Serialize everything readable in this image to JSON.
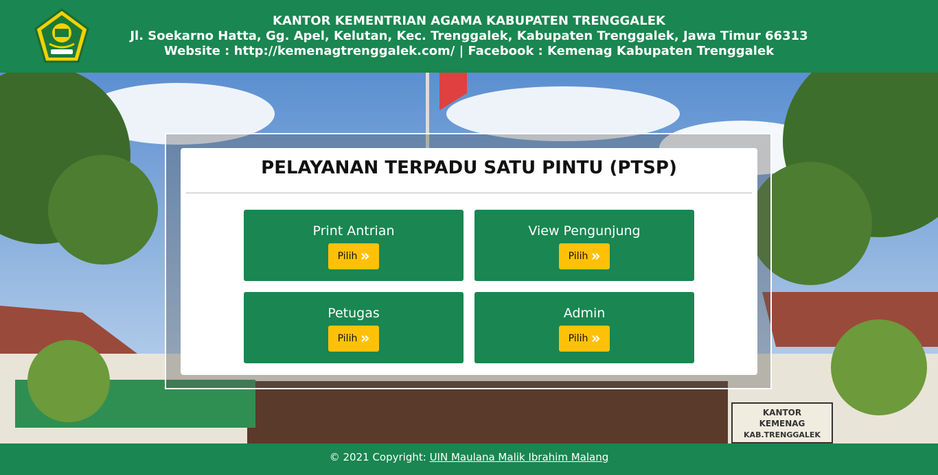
{
  "header": {
    "line1": "KANTOR KEMENTRIAN AGAMA KABUPATEN TRENGGALEK",
    "line2": "Jl. Soekarno Hatta, Gg. Apel, Kelutan, Kec. Trenggalek, Kabupaten Trenggalek, Jawa Timur 66313",
    "line3": "Website : http://kemenagtrenggalek.com/ | Facebook : Kemenag Kabupaten Trenggalek"
  },
  "card": {
    "title": "PELAYANAN TERPADU SATU PINTU (PTSP)"
  },
  "tiles": [
    {
      "label": "Print Antrian",
      "button": "Pilih"
    },
    {
      "label": "View Pengunjung",
      "button": "Pilih"
    },
    {
      "label": "Petugas",
      "button": "Pilih"
    },
    {
      "label": "Admin",
      "button": "Pilih"
    }
  ],
  "background": {
    "building_sign_line1": "KANTOR",
    "building_sign_line2": "KEMENAG",
    "building_sign_line3": "KAB.TRENGGALEK"
  },
  "footer": {
    "prefix": "© 2021 Copyright: ",
    "link": "UIN Maulana Malik Ibrahim Malang"
  },
  "colors": {
    "brand_green": "#1a8651",
    "button_yellow": "#ffc107",
    "card_bg": "#ffffff"
  },
  "icons": {
    "logo": "kemenag-emblem-icon",
    "button_icon": "double-chevron-right-icon"
  }
}
